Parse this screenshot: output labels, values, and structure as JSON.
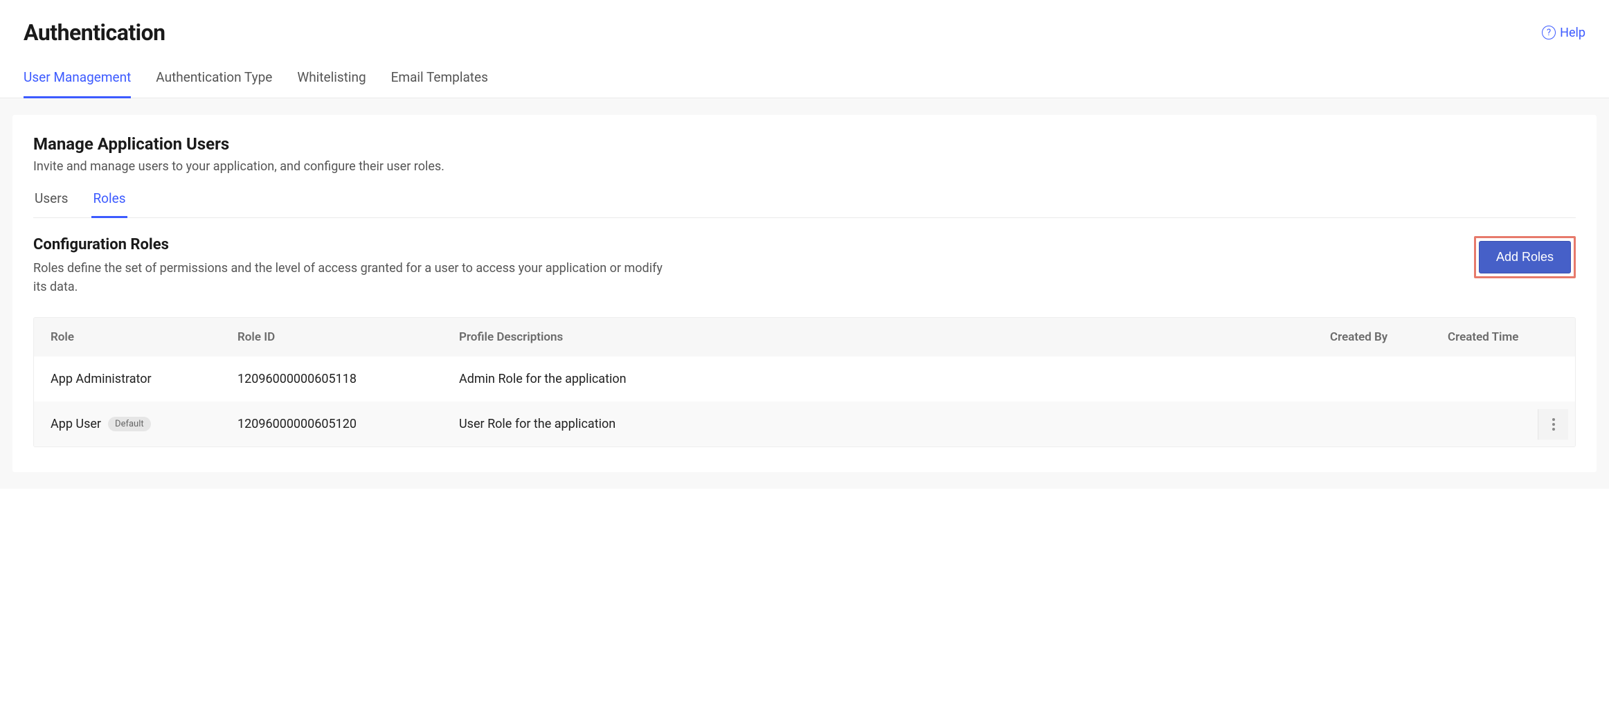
{
  "header": {
    "title": "Authentication",
    "help_label": "Help"
  },
  "top_tabs": [
    {
      "label": "User Management",
      "active": true
    },
    {
      "label": "Authentication Type",
      "active": false
    },
    {
      "label": "Whitelisting",
      "active": false
    },
    {
      "label": "Email Templates",
      "active": false
    }
  ],
  "section": {
    "title": "Manage Application Users",
    "subtitle": "Invite and manage users to your application, and configure their user roles."
  },
  "sub_tabs": [
    {
      "label": "Users",
      "active": false
    },
    {
      "label": "Roles",
      "active": true
    }
  ],
  "config": {
    "title": "Configuration Roles",
    "desc": "Roles define the set of permissions and the level of access granted for a user to access your application or modify its data.",
    "add_button": "Add Roles"
  },
  "table": {
    "columns": {
      "role": "Role",
      "role_id": "Role ID",
      "desc": "Profile Descriptions",
      "created_by": "Created By",
      "created_time": "Created Time"
    },
    "rows": [
      {
        "role": "App Administrator",
        "default": false,
        "role_id": "12096000000605118",
        "desc": "Admin Role for the application",
        "created_by": "",
        "created_time": "",
        "has_actions": false
      },
      {
        "role": "App User",
        "default": true,
        "default_label": "Default",
        "role_id": "12096000000605120",
        "desc": "User Role for the application",
        "created_by": "",
        "created_time": "",
        "has_actions": true
      }
    ]
  }
}
